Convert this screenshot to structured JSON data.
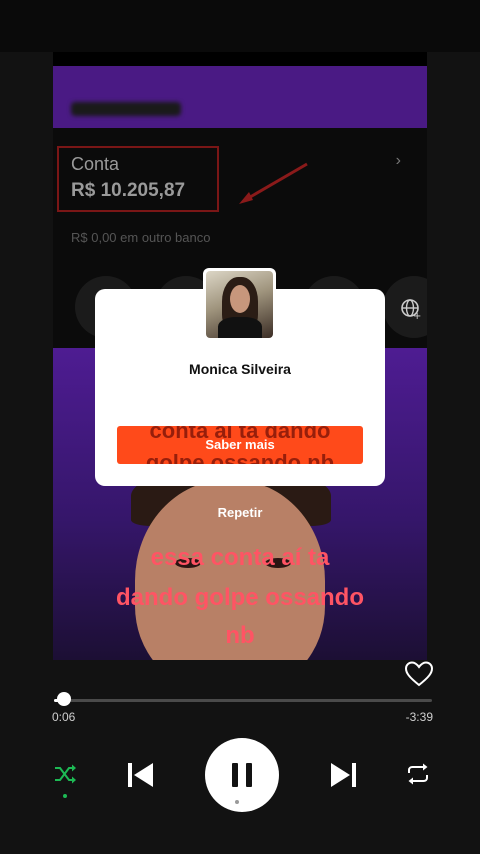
{
  "video": {
    "account_label": "Conta",
    "account_balance": "R$ 10.205,87",
    "other_bank_text": "R$ 0,00 em outro banco",
    "caption_lines": [
      "essa conta  aí ta",
      "dando golpe  ossando",
      "nb"
    ],
    "caption_behind_lines": [
      "conta  aí ta dando",
      "golpe  ossando  nb"
    ]
  },
  "popup": {
    "name": "Monica Silveira",
    "cta_label": "Saber mais",
    "replay_label": "Repetir"
  },
  "player": {
    "elapsed": "0:06",
    "remaining": "-3:39",
    "progress_fraction": 0.027,
    "accent_color": "#1db954"
  },
  "icons": {
    "like": "heart-icon",
    "shuffle": "shuffle-icon",
    "previous": "skip-previous-icon",
    "pause": "pause-icon",
    "next": "skip-next-icon",
    "repeat": "repeat-icon",
    "globe": "globe-icon"
  }
}
